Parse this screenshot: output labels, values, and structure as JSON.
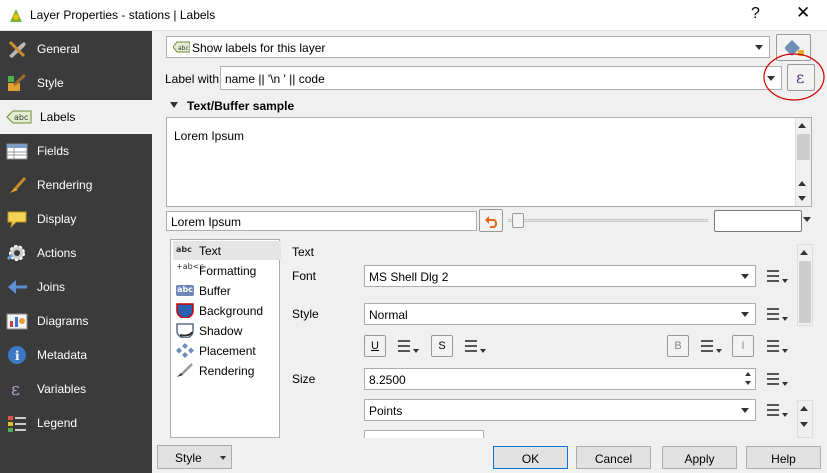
{
  "window": {
    "title": "Layer Properties - stations | Labels",
    "help_glyph": "?",
    "close_glyph": "✕"
  },
  "sidebar": {
    "items": [
      {
        "label": "General",
        "icon": "wrench-icon"
      },
      {
        "label": "Style",
        "icon": "brush-icon"
      },
      {
        "label": "Labels",
        "icon": "abc-label-icon",
        "selected": true
      },
      {
        "label": "Fields",
        "icon": "table-icon"
      },
      {
        "label": "Rendering",
        "icon": "paintbrush-icon"
      },
      {
        "label": "Display",
        "icon": "speech-bubble-icon"
      },
      {
        "label": "Actions",
        "icon": "gear-icon"
      },
      {
        "label": "Joins",
        "icon": "join-icon"
      },
      {
        "label": "Diagrams",
        "icon": "diagram-icon"
      },
      {
        "label": "Metadata",
        "icon": "info-icon"
      },
      {
        "label": "Variables",
        "icon": "epsilon-icon"
      },
      {
        "label": "Legend",
        "icon": "legend-icon"
      }
    ]
  },
  "labels": {
    "mode": "Show labels for this layer",
    "label_with_caption": "Label with",
    "label_with_value": "name || '\\n ' || code",
    "expression_glyph": "ε",
    "sample_header": "Text/Buffer sample",
    "sample_text": "Lorem Ipsum",
    "sample_input": "Lorem Ipsum",
    "tabs": [
      {
        "label": "Text",
        "icon": "abc-text-icon",
        "glyph": "abc",
        "selected": true
      },
      {
        "label": "Formatting",
        "icon": "formatting-icon",
        "glyph": "+ab<c"
      },
      {
        "label": "Buffer",
        "icon": "buffer-icon",
        "glyph": "abc"
      },
      {
        "label": "Background",
        "icon": "background-shield-icon",
        "glyph": ""
      },
      {
        "label": "Shadow",
        "icon": "shadow-icon",
        "glyph": ""
      },
      {
        "label": "Placement",
        "icon": "placement-icon",
        "glyph": ""
      },
      {
        "label": "Rendering",
        "icon": "rendering-brush-icon",
        "glyph": ""
      }
    ],
    "text": {
      "section_label": "Text",
      "font_label": "Font",
      "font_value": "MS Shell Dlg 2",
      "style_label": "Style",
      "style_value": "Normal",
      "underline_glyph": "U",
      "strike_glyph": "S",
      "bold_glyph": "B",
      "italic_glyph": "I",
      "size_label": "Size",
      "size_value": "8.2500",
      "size_unit": "Points"
    }
  },
  "footer": {
    "style_button": "Style",
    "ok": "OK",
    "cancel": "Cancel",
    "apply": "Apply",
    "help": "Help"
  }
}
